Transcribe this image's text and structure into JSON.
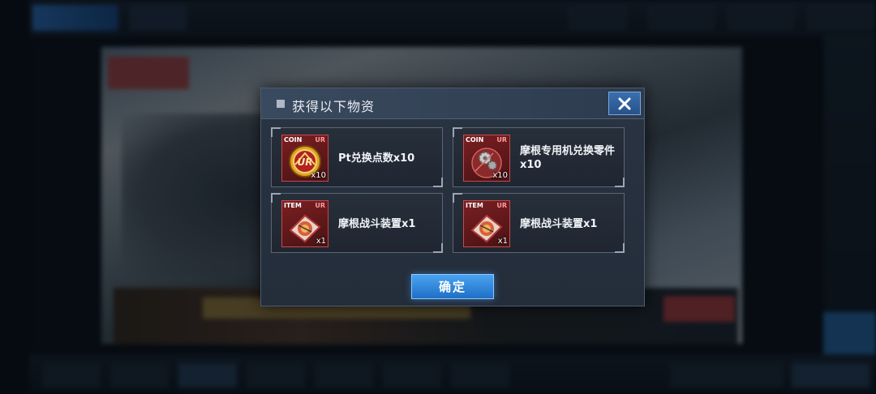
{
  "dialog": {
    "title": "获得以下物资",
    "confirm_label": "确定",
    "items": [
      {
        "tag": "COIN",
        "rarity": "UR",
        "quantity": "x10",
        "name": "Pt兑换点数x10",
        "icon": "ur-pt-coin-icon"
      },
      {
        "tag": "COIN",
        "rarity": "UR",
        "quantity": "x10",
        "name": "摩根专用机兑换零件x10",
        "icon": "gear-parts-icon"
      },
      {
        "tag": "ITEM",
        "rarity": "UR",
        "quantity": "x1",
        "name": "摩根战斗装置x1",
        "icon": "combat-device-icon"
      },
      {
        "tag": "ITEM",
        "rarity": "UR",
        "quantity": "x1",
        "name": "摩根战斗装置x1",
        "icon": "combat-device-icon"
      }
    ]
  },
  "colors": {
    "accent_blue": "#2f86e0",
    "rarity_red": "#7a1f22",
    "dialog_bg": "#252e3b"
  }
}
